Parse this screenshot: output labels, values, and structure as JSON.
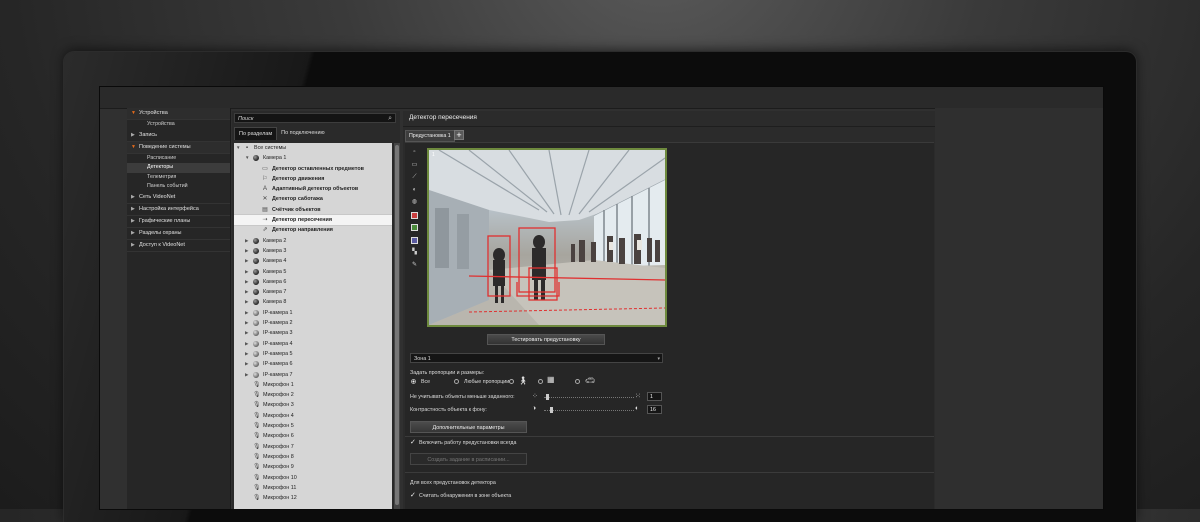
{
  "sidebar": {
    "groups": [
      {
        "label": "Устройства",
        "open": true,
        "items": [
          "Устройства"
        ]
      },
      {
        "label": "Запись",
        "open": false,
        "items": []
      },
      {
        "label": "Поведение системы",
        "open": true,
        "items": [
          "Расписание",
          "Детекторы",
          "Телеметрия",
          "Панель событий"
        ],
        "selected": "Детекторы"
      },
      {
        "label": "Сеть VideoNet",
        "open": false,
        "items": []
      },
      {
        "label": "Настройка интерфейса",
        "open": false,
        "items": []
      },
      {
        "label": "Графические планы",
        "open": false,
        "items": []
      },
      {
        "label": "Разделы охраны",
        "open": false,
        "items": []
      },
      {
        "label": "Доступ к VideoNet",
        "open": false,
        "items": []
      }
    ]
  },
  "tree_panel": {
    "search_placeholder": "Поиск",
    "tabs": [
      "По разделам",
      "По подключению"
    ],
    "root": "Все системы",
    "camera1": "Камера 1",
    "detectors": [
      {
        "label": "Детектор оставленных предметов",
        "icon": "box-icon"
      },
      {
        "label": "Детектор движения",
        "icon": "run-icon"
      },
      {
        "label": "Адаптивный детектор объектов",
        "icon": "letter-a-icon"
      },
      {
        "label": "Детектор саботажа",
        "icon": "cross-icon"
      },
      {
        "label": "Счётчик объектов",
        "icon": "counter-icon"
      },
      {
        "label": "Детектор пересечения",
        "icon": "crossing-icon"
      },
      {
        "label": "Детектор направления",
        "icon": "direction-icon"
      }
    ],
    "highlighted": "Детектор пересечения",
    "cameras": [
      "Камера 2",
      "Камера 3",
      "Камера 4",
      "Камера 5",
      "Камера 6",
      "Камера 7",
      "Камера 8"
    ],
    "ip_cameras": [
      "IP-камера 1",
      "IP-камера 2",
      "IP-камера 3",
      "IP-камера 4",
      "IP-камера 5",
      "IP-камера 6",
      "IP-камера 7"
    ],
    "microphones": [
      "Микрофон 1",
      "Микрофон 2",
      "Микрофон 3",
      "Микрофон 4",
      "Микрофон 5",
      "Микрофон 6",
      "Микрофон 7",
      "Микрофон 8",
      "Микрофон 9",
      "Микрофон 10",
      "Микрофон 11",
      "Микрофон 12"
    ]
  },
  "detail": {
    "title": "Детектор пересечения",
    "preset_tab": "Предустановка 1",
    "add_symbol": "+",
    "video_number": "1",
    "test_button": "Тестировать предустановку",
    "zone": "Зона 1",
    "proportions_label": "Задать пропорции и размеры:",
    "radio_all": "Все",
    "radio_any": "Любые пропорции",
    "ignore_small_label": "Не учитывать объекты меньше заданного:",
    "ignore_small_value": "1",
    "contrast_label": "Контрастность объекта к фону:",
    "contrast_value": "16",
    "advanced_button": "Дополнительные параметры",
    "always_on_label": "Включить работу предустановки всегда",
    "schedule_button": "Создать задание в расписании...",
    "all_presets_label": "Для всех предустановок детектора",
    "count_label": "Считать обнаружения в зоне объекта"
  },
  "colors": {
    "accent": "#e46a1a",
    "video_border": "#6e8a3e",
    "detect_red": "#e03030"
  }
}
